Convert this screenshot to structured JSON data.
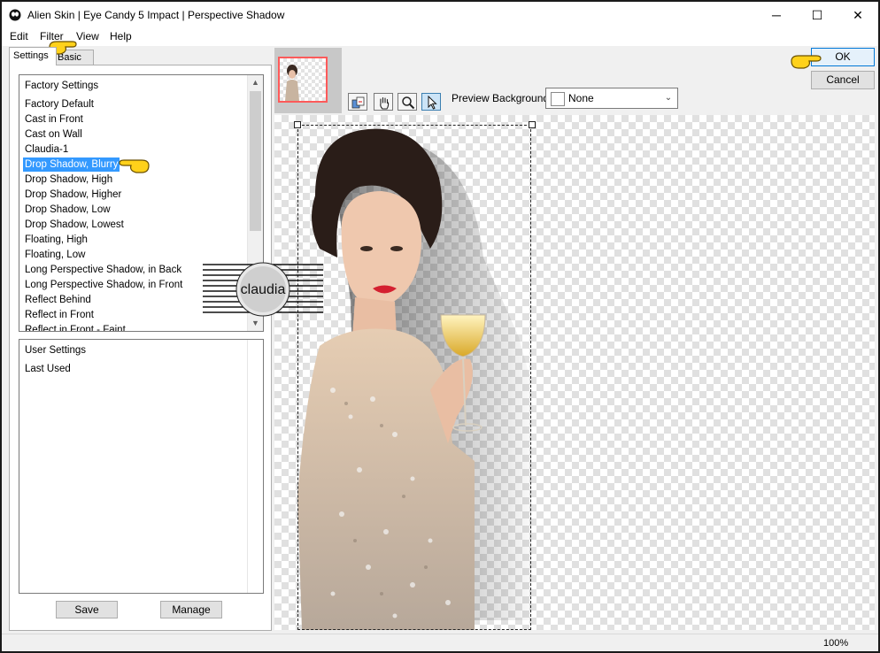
{
  "window": {
    "title": "Alien Skin | Eye Candy 5 Impact | Perspective Shadow",
    "minimize_symbol": "─",
    "maximize_symbol": "☐",
    "close_symbol": "✕"
  },
  "menu": [
    "Edit",
    "Filter",
    "View",
    "Help"
  ],
  "tabs": {
    "settings": "Settings",
    "basic": "Basic"
  },
  "factory_settings": {
    "header": "Factory Settings",
    "items": [
      "Factory Default",
      "Cast in Front",
      "Cast on Wall",
      "Claudia-1",
      "Drop Shadow, Blurry",
      "Drop Shadow, High",
      "Drop Shadow, Higher",
      "Drop Shadow, Low",
      "Drop Shadow, Lowest",
      "Floating, High",
      "Floating, Low",
      "Long Perspective Shadow, in Back",
      "Long Perspective Shadow, in Front",
      "Reflect Behind",
      "Reflect in Front",
      "Reflect in Front - Faint"
    ],
    "selected": "Drop Shadow, Blurry"
  },
  "user_settings": {
    "header": "User Settings",
    "items": [
      "Last Used"
    ]
  },
  "buttons": {
    "save": "Save",
    "manage": "Manage",
    "ok": "OK",
    "cancel": "Cancel"
  },
  "preview_background": {
    "label": "Preview Background:",
    "value": "None"
  },
  "watermark_text": "claudia",
  "status": {
    "zoom": "100%"
  },
  "icons": {
    "app": "alien-skin-app-icon",
    "tools": [
      "preview-toggle-icon",
      "hand-pan-icon",
      "zoom-magnifier-icon",
      "select-arrow-icon"
    ],
    "pointer": "pointing-hand-icon"
  },
  "colors": {
    "selection": "#3399ff",
    "ok_border": "#0078d7",
    "thumb_border": "#ff5a5a"
  }
}
